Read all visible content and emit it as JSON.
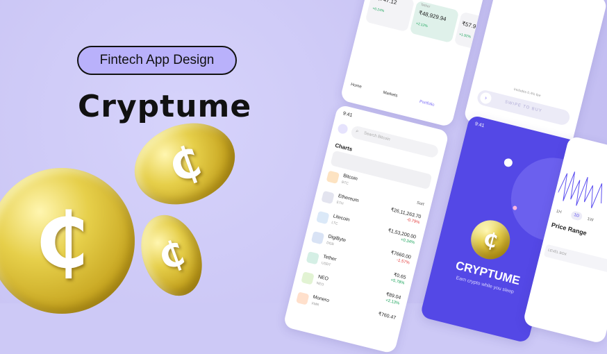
{
  "badge": "Fintech App Design",
  "brand": "Cryptume",
  "coin_symbol": "₵",
  "top_cards": {
    "values": [
      "₹,747.12",
      "₹48,929.94",
      "₹57.9"
    ],
    "changes": [
      "+0.24%",
      "+2.12%",
      "+1.92%"
    ],
    "card_label": "Tether"
  },
  "tabs": {
    "home": "Home",
    "markets": "Markets",
    "portfolio": "Portfolio"
  },
  "status_time": "9:41",
  "search_placeholder": "Search Bitcoin",
  "charts_title": "Charts",
  "sort_label": "Sort",
  "coins": [
    {
      "name": "Bitcoin",
      "sym": "BTC",
      "value": "",
      "change": "",
      "color": "#f7931a"
    },
    {
      "name": "Ethereum",
      "sym": "ETH",
      "value": "₹26,11,263.70",
      "change": "-0.79%",
      "color": "#8a8fb5"
    },
    {
      "name": "Litecoin",
      "sym": "LTC",
      "value": "₹1,53,200.00",
      "change": "+0.34%",
      "color": "#3f8edb"
    },
    {
      "name": "DigiByte",
      "sym": "DGB",
      "value": "₹7660.00",
      "change": "-1.57%",
      "color": "#1f5fbf"
    },
    {
      "name": "Tether",
      "sym": "USDT",
      "value": "₹0.65",
      "change": "+5.78%",
      "color": "#26a17b"
    },
    {
      "name": "NEO",
      "sym": "NEO",
      "value": "₹89.04",
      "change": "+2.13%",
      "color": "#58bf00"
    },
    {
      "name": "Monero",
      "sym": "XMR",
      "value": "₹760.47",
      "change": "",
      "color": "#ff6600"
    }
  ],
  "purchase": {
    "note": "Includes 0.4% fee",
    "button": "SWIPE TO BUY"
  },
  "splash": {
    "time": "9:41",
    "title": "CRYPTUME",
    "subtitle": "Earn crypto while you sleep"
  },
  "price_panel": {
    "ranges": [
      "1H",
      "1D",
      "1W"
    ],
    "title": "Price Range",
    "footer": "LEVEL BOX"
  }
}
